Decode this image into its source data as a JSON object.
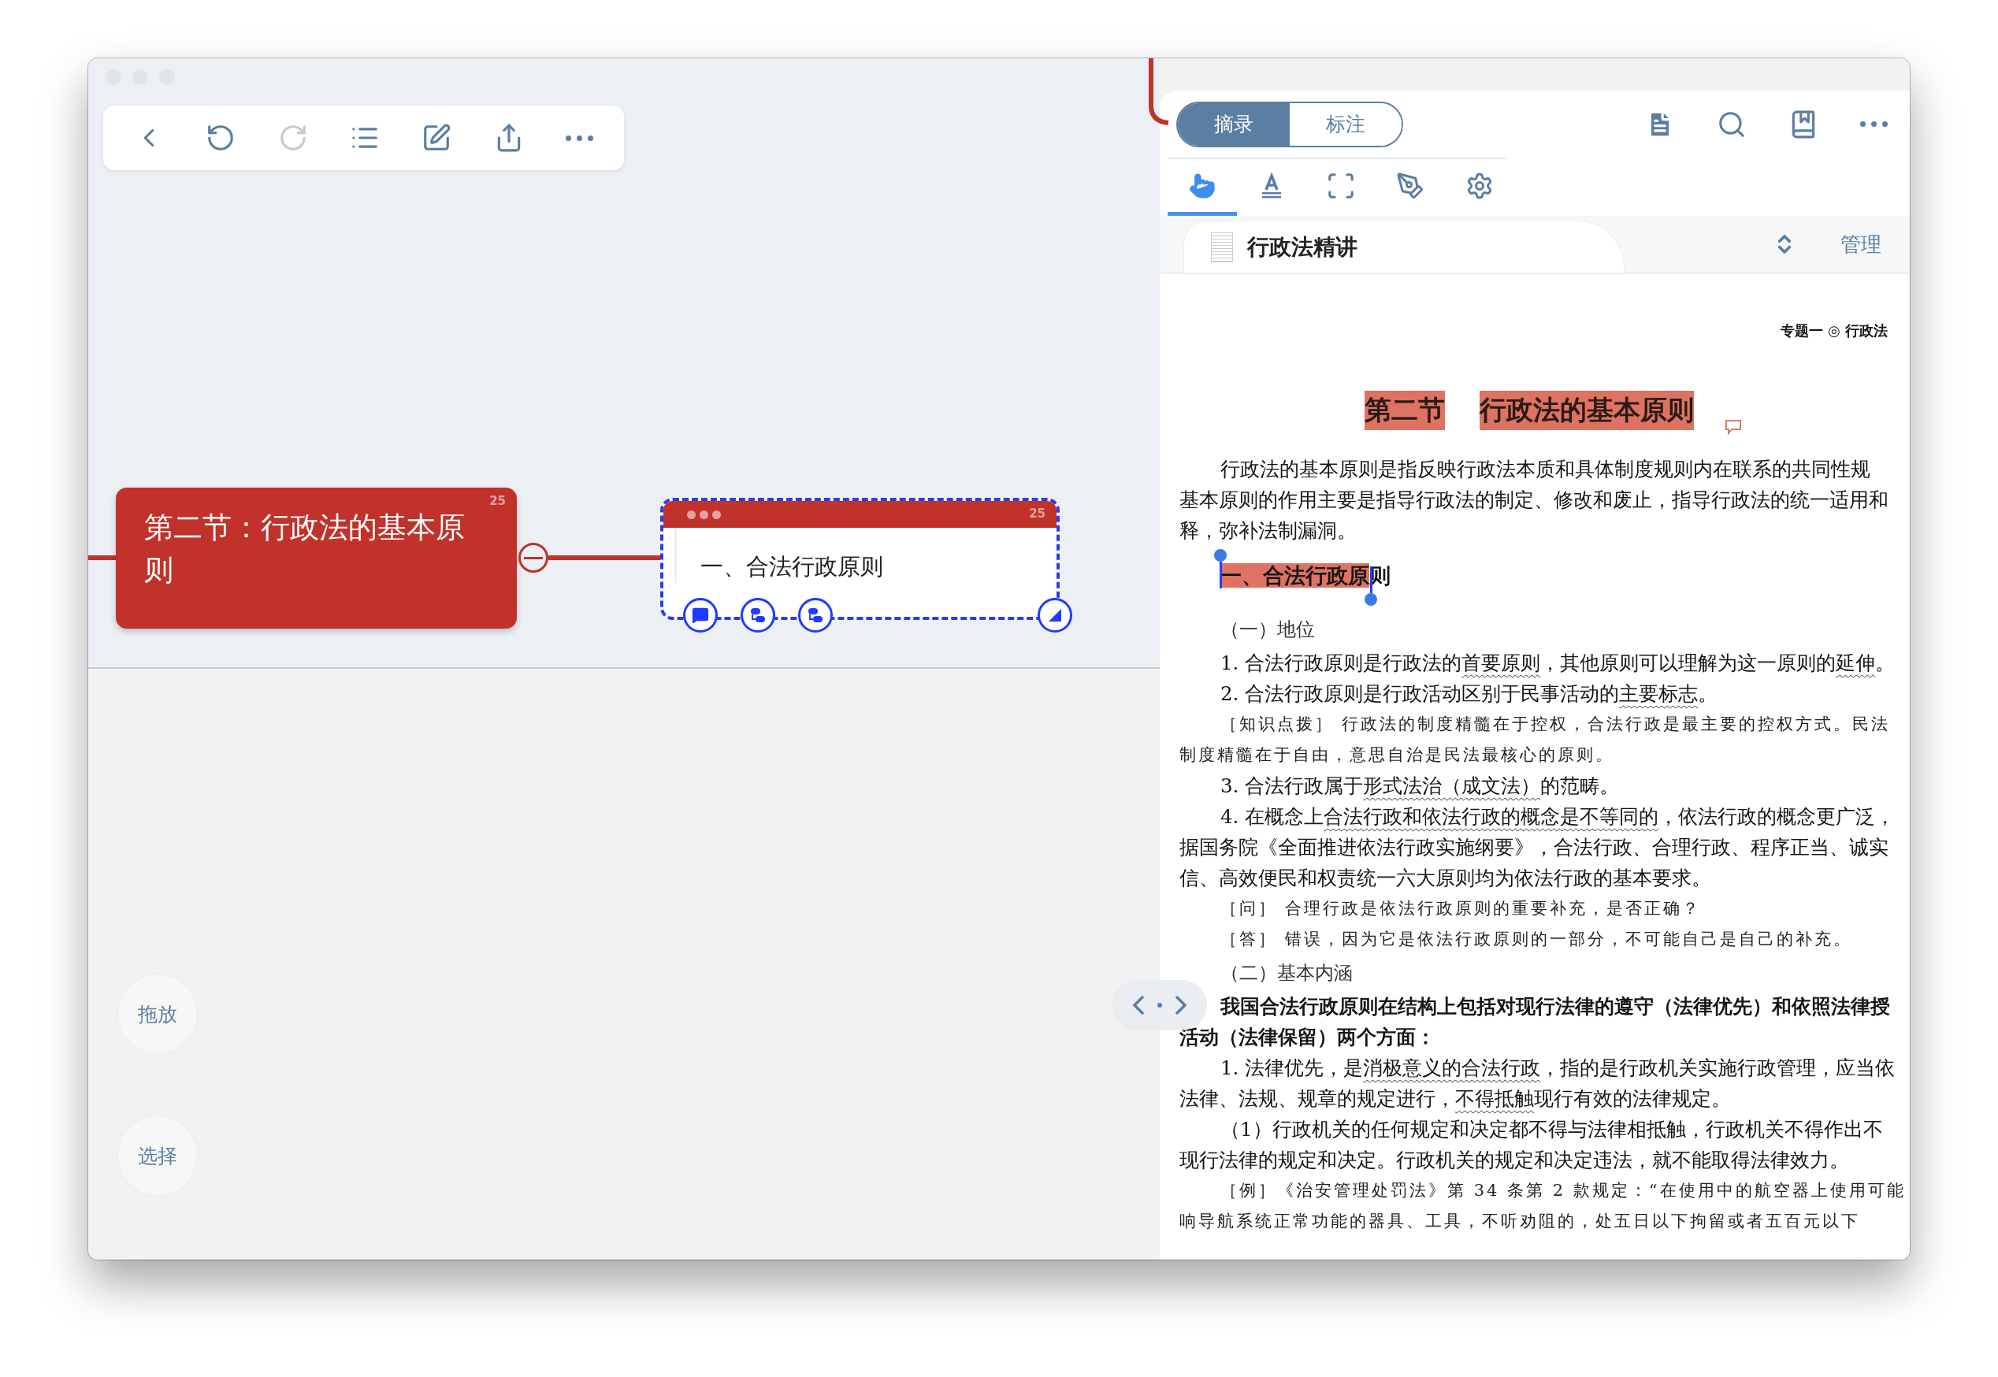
{
  "window": {
    "active": false
  },
  "toolbar": [
    {
      "kind": "back",
      "disabled": false
    },
    {
      "kind": "undo",
      "disabled": false
    },
    {
      "kind": "redo",
      "disabled": true
    },
    {
      "kind": "outline",
      "disabled": false
    },
    {
      "kind": "edit",
      "disabled": false
    },
    {
      "kind": "share",
      "disabled": false
    },
    {
      "kind": "more",
      "disabled": false
    }
  ],
  "mind_map": {
    "root": {
      "title": "第二节：行政法的基本原则",
      "count": "25",
      "expanded": true
    },
    "child": {
      "title": "一、合法行政原则",
      "count": "25",
      "selected": true
    }
  },
  "side_buttons": [
    {
      "label": "拖放"
    },
    {
      "label": "选择"
    }
  ],
  "tabs": [
    {
      "label": "摘录",
      "selected": true
    },
    {
      "label": "标注",
      "selected": false
    }
  ],
  "header_icons": [
    {
      "kind": "document"
    },
    {
      "kind": "search"
    },
    {
      "kind": "bookmark"
    },
    {
      "kind": "more"
    }
  ],
  "tools": [
    {
      "kind": "hand",
      "selected": true
    },
    {
      "kind": "text",
      "selected": false
    },
    {
      "kind": "rect",
      "selected": false
    },
    {
      "kind": "lasso",
      "selected": false
    },
    {
      "kind": "settings",
      "selected": false
    }
  ],
  "document_tab": {
    "title": "行政法精讲",
    "manage": "管理"
  },
  "page": {
    "running_head": "专题一 ◎ 行政法",
    "lines": [
      {
        "kind": "chapter",
        "segments": [
          {
            "text": "第二节",
            "highlighted": true
          },
          {
            "text": "行政法的基本原则",
            "highlighted": true
          }
        ]
      },
      {
        "kind": "body",
        "indent": true,
        "segments": [
          {
            "text": "行政法的基本原则是指反映行政法本质和具体制度规则内在联系的共同性规",
            "underlined": false
          }
        ]
      },
      {
        "kind": "body",
        "indent": false,
        "segments": [
          {
            "text": "基本原则的作用主要是指导行政法的制定、修改和废止，指导行政法的统一适用和",
            "underlined": false
          }
        ]
      },
      {
        "kind": "body",
        "indent": false,
        "segments": [
          {
            "text": "释，弥补法制漏洞。",
            "underlined": false
          }
        ]
      },
      {
        "kind": "section",
        "indent": true,
        "selected": true,
        "segments": [
          {
            "text": "一、合法行政原",
            "highlighted": true
          },
          {
            "text": "则",
            "highlighted": false
          }
        ]
      },
      {
        "kind": "subhead",
        "indent": true,
        "segments": [
          {
            "text": "（一）地位",
            "underlined": false
          }
        ]
      },
      {
        "kind": "body",
        "indent": true,
        "segments": [
          {
            "text": "1. 合法行政原则是行政法的",
            "underlined": false
          },
          {
            "text": "首要原则",
            "underlined": true
          },
          {
            "text": "，其他原则可以理解为这一原则的",
            "underlined": false
          },
          {
            "text": "延伸",
            "underlined": true
          },
          {
            "text": "。",
            "underlined": false
          }
        ]
      },
      {
        "kind": "body",
        "indent": true,
        "segments": [
          {
            "text": "2. 合法行政原则是行政活动区别于民事活动的",
            "underlined": false
          },
          {
            "text": "主要标志",
            "underlined": true
          },
          {
            "text": "。",
            "underlined": false
          }
        ]
      },
      {
        "kind": "note",
        "indent": true,
        "segments": [
          {
            "text": "［知识点拨］ 行政法的制度精髓在于控权，合法行政是最主要的控权方式。民法"
          }
        ]
      },
      {
        "kind": "note",
        "indent": false,
        "segments": [
          {
            "text": "制度精髓在于自由，意思自治是民法最核心的原则。"
          }
        ]
      },
      {
        "kind": "body",
        "indent": true,
        "segments": [
          {
            "text": "3. 合法行政属于",
            "underlined": false
          },
          {
            "text": "形式法治（成文法）",
            "underlined": true
          },
          {
            "text": "的范畴。",
            "underlined": false
          }
        ]
      },
      {
        "kind": "body",
        "indent": true,
        "segments": [
          {
            "text": "4. 在概念上",
            "underlined": false
          },
          {
            "text": "合法行政和依法行政的概念是不等同的",
            "underlined": true
          },
          {
            "text": "，依法行政的概念更广泛，",
            "underlined": false
          }
        ]
      },
      {
        "kind": "body",
        "indent": false,
        "segments": [
          {
            "text": "据国务院《全面推进依法行政实施纲要》，合法行政、合理行政、程序正当、诚实",
            "underlined": false
          }
        ]
      },
      {
        "kind": "body",
        "indent": false,
        "segments": [
          {
            "text": "信、高效便民和权责统一六大原则均为依法行政的基本要求。",
            "underlined": false
          }
        ]
      },
      {
        "kind": "note",
        "indent": true,
        "segments": [
          {
            "text": "［问］ 合理行政是依法行政原则的重要补充，是否正确？"
          }
        ]
      },
      {
        "kind": "note",
        "indent": true,
        "segments": [
          {
            "text": "［答］ 错误，因为它是依法行政原则的一部分，不可能自己是自己的补充。"
          }
        ]
      },
      {
        "kind": "subhead",
        "indent": true,
        "segments": [
          {
            "text": "（二）基本内涵",
            "underlined": false
          }
        ]
      },
      {
        "kind": "bold",
        "indent": true,
        "segments": [
          {
            "text": "我国合法行政原则在结构上包括对现行法律的遵守（法律优先）和依照法律授",
            "underlined": false
          }
        ]
      },
      {
        "kind": "bold",
        "indent": false,
        "segments": [
          {
            "text": "活动（法律保留）两个方面：",
            "underlined": false
          }
        ]
      },
      {
        "kind": "body",
        "indent": true,
        "segments": [
          {
            "text": "1. 法律优先，是",
            "underlined": false
          },
          {
            "text": "消极意义的合法行政",
            "underlined": true
          },
          {
            "text": "，指的是行政机关实施行政管理，应当依",
            "underlined": false
          }
        ]
      },
      {
        "kind": "body",
        "indent": false,
        "segments": [
          {
            "text": "法律、法规、规章的规定进行，",
            "underlined": false
          },
          {
            "text": "不得抵触",
            "underlined": true
          },
          {
            "text": "现行有效的法律规定。",
            "underlined": false
          }
        ]
      },
      {
        "kind": "body",
        "indent": true,
        "segments": [
          {
            "text": "（1）行政机关的任何规定和决定都不得与法律相抵触，行政机关不得作出不",
            "underlined": false
          }
        ]
      },
      {
        "kind": "body",
        "indent": false,
        "segments": [
          {
            "text": "现行法律的规定和决定。行政机关的规定和决定违法，就不能取得法律效力。",
            "underlined": false
          }
        ]
      },
      {
        "kind": "note",
        "indent": true,
        "segments": [
          {
            "text": "［例］《治安管理处罚法》第 34 条第 2 款规定：“在使用中的航空器上使用可能"
          }
        ]
      },
      {
        "kind": "note",
        "indent": false,
        "segments": [
          {
            "text": "响导航系统正常功能的器具、工具，不听劝阻的，处五日以下拘留或者五百元以下"
          }
        ]
      }
    ]
  }
}
